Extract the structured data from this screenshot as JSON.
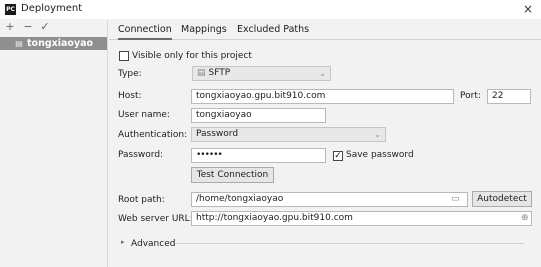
{
  "window": {
    "app_icon_text": "PC",
    "title": "Deployment",
    "close_glyph": "×"
  },
  "toolbar": {
    "add": "+",
    "remove": "−",
    "check": "✓"
  },
  "servers": [
    {
      "icon": "server-icon",
      "name": "tongxiaoyao",
      "selected": true
    }
  ],
  "tabs": [
    {
      "label": "Connection",
      "active": true
    },
    {
      "label": "Mappings",
      "active": false
    },
    {
      "label": "Excluded Paths",
      "active": false
    }
  ],
  "form": {
    "visible_only_label": "Visible only for this project",
    "visible_only_checked": false,
    "type_label": "Type:",
    "type_value": "SFTP",
    "host_label": "Host:",
    "host_value": "tongxiaoyao.gpu.bit910.com",
    "port_label": "Port:",
    "port_value": "22",
    "username_label": "User name:",
    "username_value": "tongxiaoyao",
    "auth_label": "Authentication:",
    "auth_value": "Password",
    "password_label": "Password:",
    "password_value": "••••••",
    "save_password_label": "Save password",
    "save_password_checked": true,
    "test_connection_label": "Test Connection",
    "root_path_label": "Root path:",
    "root_path_value": "/home/tongxiaoyao",
    "autodetect_label": "Autodetect",
    "web_url_label": "Web server URL:",
    "web_url_value": "http://tongxiaoyao.gpu.bit910.com",
    "advanced_label": "Advanced"
  },
  "icons": {
    "check_mark": "✓",
    "chevron": "⌄",
    "expand_arrow": "▸",
    "folder": "▭",
    "globe": "⊕",
    "sftp": "▤",
    "server": "▤"
  }
}
